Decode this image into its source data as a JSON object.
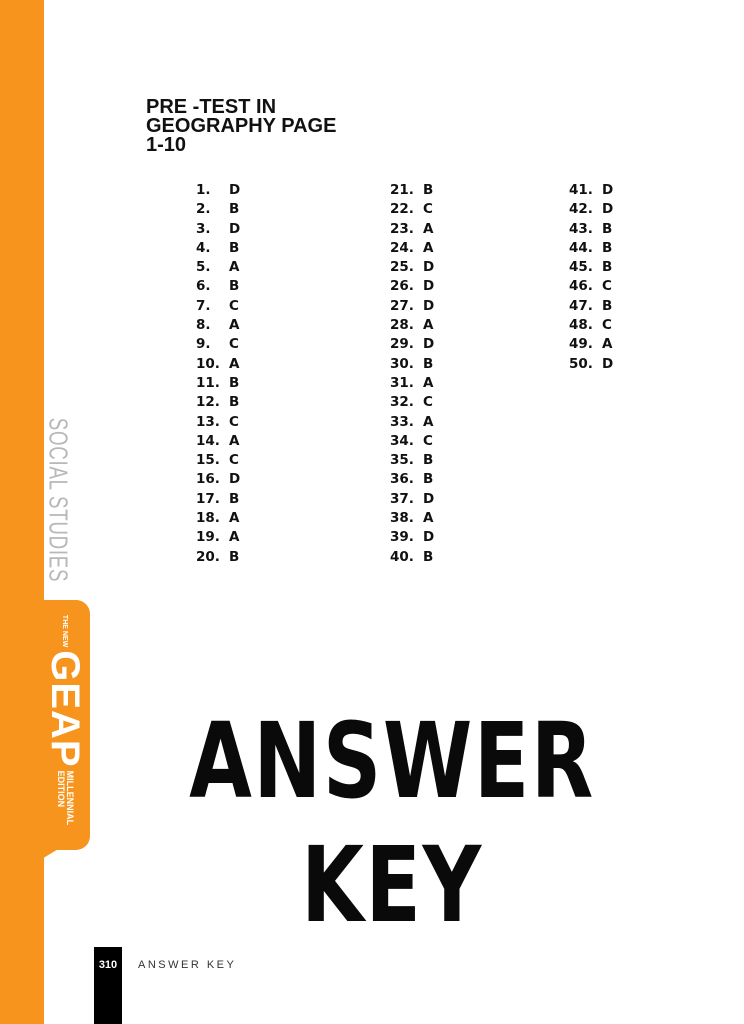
{
  "sidebar": {
    "subject": "SOCIAL STUDIES",
    "brand_new": "THE NEW",
    "brand_name": "GEAP",
    "brand_edition_1": "MILLENNIAL",
    "brand_edition_2": "EDITION",
    "accent": "#f7941d"
  },
  "title": {
    "line1": "PRE -TEST IN",
    "line2": "GEOGRAPHY PAGE",
    "line3": "1-10"
  },
  "answers": {
    "col1": [
      {
        "n": "1.",
        "a": "D"
      },
      {
        "n": "2.",
        "a": "B"
      },
      {
        "n": "3.",
        "a": "D"
      },
      {
        "n": "4.",
        "a": "B"
      },
      {
        "n": "5.",
        "a": "A"
      },
      {
        "n": "6.",
        "a": "B"
      },
      {
        "n": "7.",
        "a": "C"
      },
      {
        "n": "8.",
        "a": "A"
      },
      {
        "n": "9.",
        "a": "C"
      },
      {
        "n": "10.",
        "a": "A"
      },
      {
        "n": "11.",
        "a": "B"
      },
      {
        "n": "12.",
        "a": "B"
      },
      {
        "n": "13.",
        "a": "C"
      },
      {
        "n": "14.",
        "a": "A"
      },
      {
        "n": "15.",
        "a": "C"
      },
      {
        "n": "16.",
        "a": "D"
      },
      {
        "n": "17.",
        "a": "B"
      },
      {
        "n": "18.",
        "a": "A"
      },
      {
        "n": "19.",
        "a": "A"
      },
      {
        "n": "20.",
        "a": "B"
      }
    ],
    "col2": [
      {
        "n": "21.",
        "a": "B"
      },
      {
        "n": "22.",
        "a": "C"
      },
      {
        "n": "23.",
        "a": "A"
      },
      {
        "n": "24.",
        "a": "A"
      },
      {
        "n": "25.",
        "a": "D"
      },
      {
        "n": "26.",
        "a": "D"
      },
      {
        "n": "27.",
        "a": "D"
      },
      {
        "n": "28.",
        "a": "A"
      },
      {
        "n": "29.",
        "a": "D"
      },
      {
        "n": "30.",
        "a": "B"
      },
      {
        "n": "31.",
        "a": "A"
      },
      {
        "n": "32.",
        "a": "C"
      },
      {
        "n": "33.",
        "a": "A"
      },
      {
        "n": "34.",
        "a": "C"
      },
      {
        "n": "35.",
        "a": "B"
      },
      {
        "n": "36.",
        "a": "B"
      },
      {
        "n": "37.",
        "a": "D"
      },
      {
        "n": "38.",
        "a": "A"
      },
      {
        "n": "39.",
        "a": "D"
      },
      {
        "n": "40.",
        "a": "B"
      }
    ],
    "col3": [
      {
        "n": "41.",
        "a": "D"
      },
      {
        "n": "42.",
        "a": "D"
      },
      {
        "n": "43.",
        "a": "B"
      },
      {
        "n": "44.",
        "a": "B"
      },
      {
        "n": "45.",
        "a": "B"
      },
      {
        "n": "46.",
        "a": "C"
      },
      {
        "n": "47.",
        "a": "B"
      },
      {
        "n": "48.",
        "a": "C"
      },
      {
        "n": "49.",
        "a": "A"
      },
      {
        "n": "50.",
        "a": "D"
      }
    ]
  },
  "heading": {
    "line1": "ANSWER",
    "line2": "KEY"
  },
  "footer": {
    "page_number": "310",
    "section": "ANSWER KEY"
  }
}
